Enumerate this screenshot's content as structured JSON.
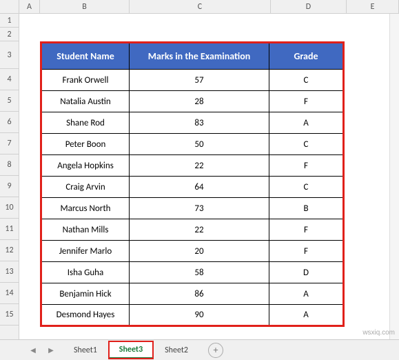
{
  "columns": [
    "A",
    "B",
    "C",
    "D",
    "E"
  ],
  "rows": [
    "1",
    "2",
    "3",
    "4",
    "5",
    "6",
    "7",
    "8",
    "9",
    "10",
    "11",
    "12",
    "13",
    "14",
    "15"
  ],
  "table": {
    "headers": [
      "Student Name",
      "Marks in the Examination",
      "Grade"
    ],
    "data": [
      {
        "name": "Frank Orwell",
        "marks": "57",
        "grade": "C"
      },
      {
        "name": "Natalia Austin",
        "marks": "28",
        "grade": "F"
      },
      {
        "name": "Shane Rod",
        "marks": "83",
        "grade": "A"
      },
      {
        "name": "Peter Boon",
        "marks": "50",
        "grade": "C"
      },
      {
        "name": "Angela Hopkins",
        "marks": "22",
        "grade": "F"
      },
      {
        "name": "Craig Arvin",
        "marks": "64",
        "grade": "C"
      },
      {
        "name": "Marcus North",
        "marks": "73",
        "grade": "B"
      },
      {
        "name": "Nathan Mills",
        "marks": "22",
        "grade": "F"
      },
      {
        "name": "Jennifer Marlo",
        "marks": "20",
        "grade": "F"
      },
      {
        "name": "Isha Guha",
        "marks": "58",
        "grade": "D"
      },
      {
        "name": "Benjamin Hick",
        "marks": "86",
        "grade": "A"
      },
      {
        "name": "Desmond Hayes",
        "marks": "90",
        "grade": "A"
      }
    ]
  },
  "sheets": {
    "items": [
      {
        "label": "Sheet1",
        "active": false
      },
      {
        "label": "Sheet3",
        "active": true
      },
      {
        "label": "Sheet2",
        "active": false
      }
    ]
  },
  "watermark": "wsxiq.com"
}
